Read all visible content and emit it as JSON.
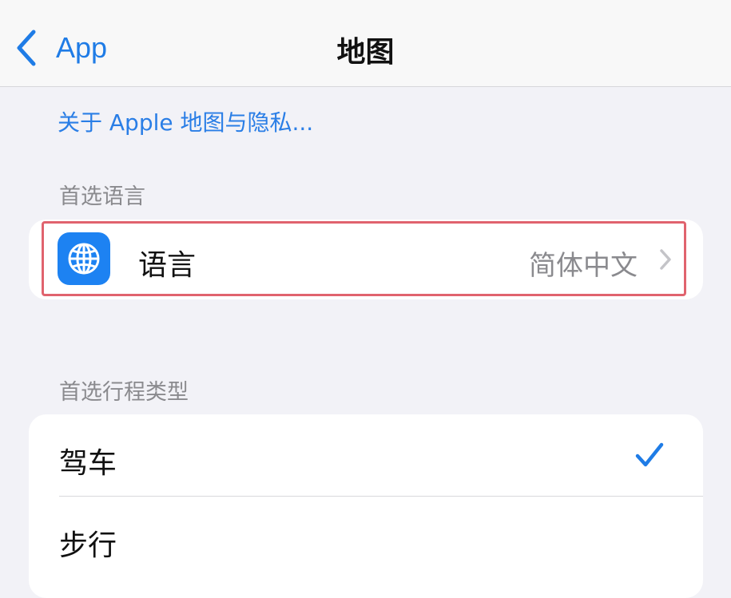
{
  "nav": {
    "back_label": "App",
    "title": "地图"
  },
  "privacy_link": "关于 Apple 地图与隐私...",
  "language_section": {
    "header": "首选语言",
    "row": {
      "label": "语言",
      "value": "简体中文",
      "icon": "globe-icon"
    }
  },
  "travel_section": {
    "header": "首选行程类型",
    "items": [
      {
        "label": "驾车",
        "selected": true
      },
      {
        "label": "步行",
        "selected": false
      }
    ]
  },
  "colors": {
    "accent": "#1f7ce6",
    "highlight": "#e0636e",
    "icon_bg": "#1d82f2"
  }
}
